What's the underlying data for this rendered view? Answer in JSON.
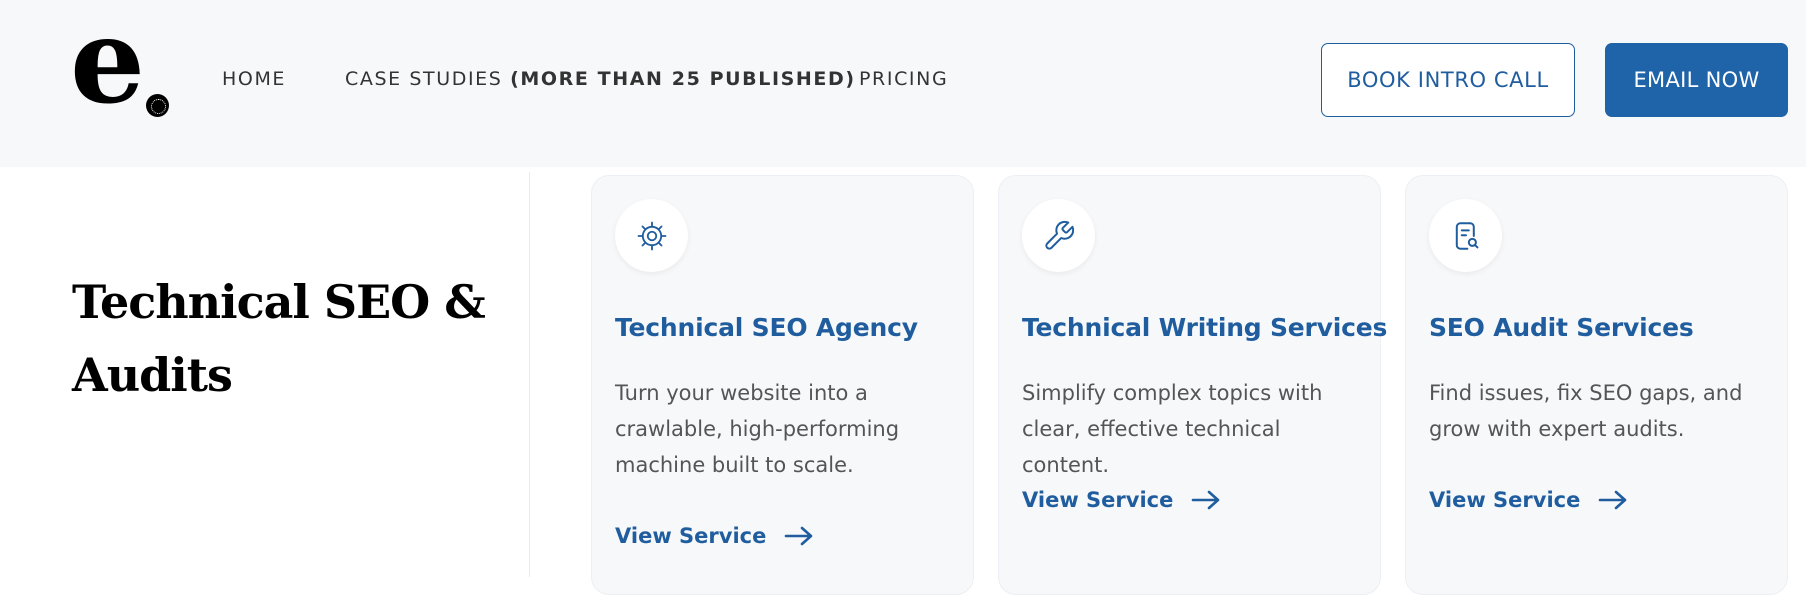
{
  "header": {
    "logo_letter": "e",
    "nav": {
      "home": "HOME",
      "case_studies": "CASE STUDIES",
      "case_studies_note": "(MORE THAN 25 PUBLISHED)",
      "pricing": "PRICING"
    },
    "book_call_label": "BOOK INTRO CALL",
    "email_label": "EMAIL NOW"
  },
  "section": {
    "title": "Technical SEO & Audits"
  },
  "cards": [
    {
      "icon": "gear-icon",
      "title": "Technical SEO Agency",
      "description": "Turn your website into a crawlable, high-performing machine built to scale.",
      "link_label": "View Service"
    },
    {
      "icon": "wrench-icon",
      "title": "Technical Writing Services",
      "description": "Simplify complex topics with clear, effective technical content.",
      "link_label": "View Service"
    },
    {
      "icon": "document-search-icon",
      "title": "SEO Audit Services",
      "description": "Find issues, fix SEO gaps, and grow with expert audits.",
      "link_label": "View Service"
    }
  ],
  "colors": {
    "accent": "#1f5d9e",
    "button_bg": "#1f63a8",
    "header_bg": "#f7f8fa",
    "card_bg": "#f7f8fa"
  }
}
